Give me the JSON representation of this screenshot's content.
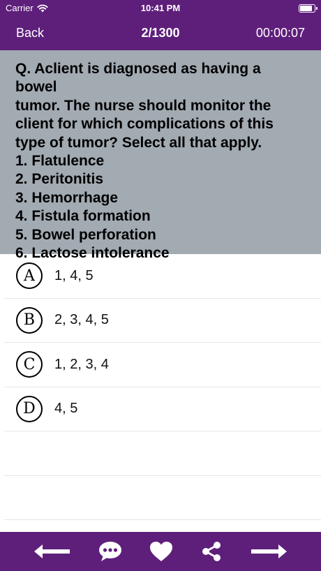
{
  "status_bar": {
    "carrier": "Carrier",
    "time": "10:41 PM",
    "battery_level": 0.85
  },
  "nav": {
    "back_label": "Back",
    "progress": "2/1300",
    "timer": "00:00:07"
  },
  "question": {
    "lines": [
      "Q. Aclient is diagnosed as having a bowel",
      "tumor. The nurse should monitor the",
      "client for which complications of this",
      "type of tumor? Select all that apply.",
      "1. Flatulence",
      "2. Peritonitis",
      "3. Hemorrhage",
      "4. Fistula formation",
      "5. Bowel perforation",
      "6. Lactose intolerance"
    ]
  },
  "options": [
    {
      "letter": "A",
      "text": "1, 4, 5"
    },
    {
      "letter": "B",
      "text": "2, 3, 4, 5"
    },
    {
      "letter": "C",
      "text": "1, 2, 3, 4"
    },
    {
      "letter": "D",
      "text": "4, 5"
    }
  ],
  "toolbar": {
    "icons": [
      "arrow-left-icon",
      "chat-bubble-icon",
      "heart-icon",
      "share-icon",
      "arrow-right-icon"
    ]
  },
  "colors": {
    "primary": "#5e1f7b",
    "question_bg": "#a2aab2",
    "divider": "#e6e6e6"
  }
}
